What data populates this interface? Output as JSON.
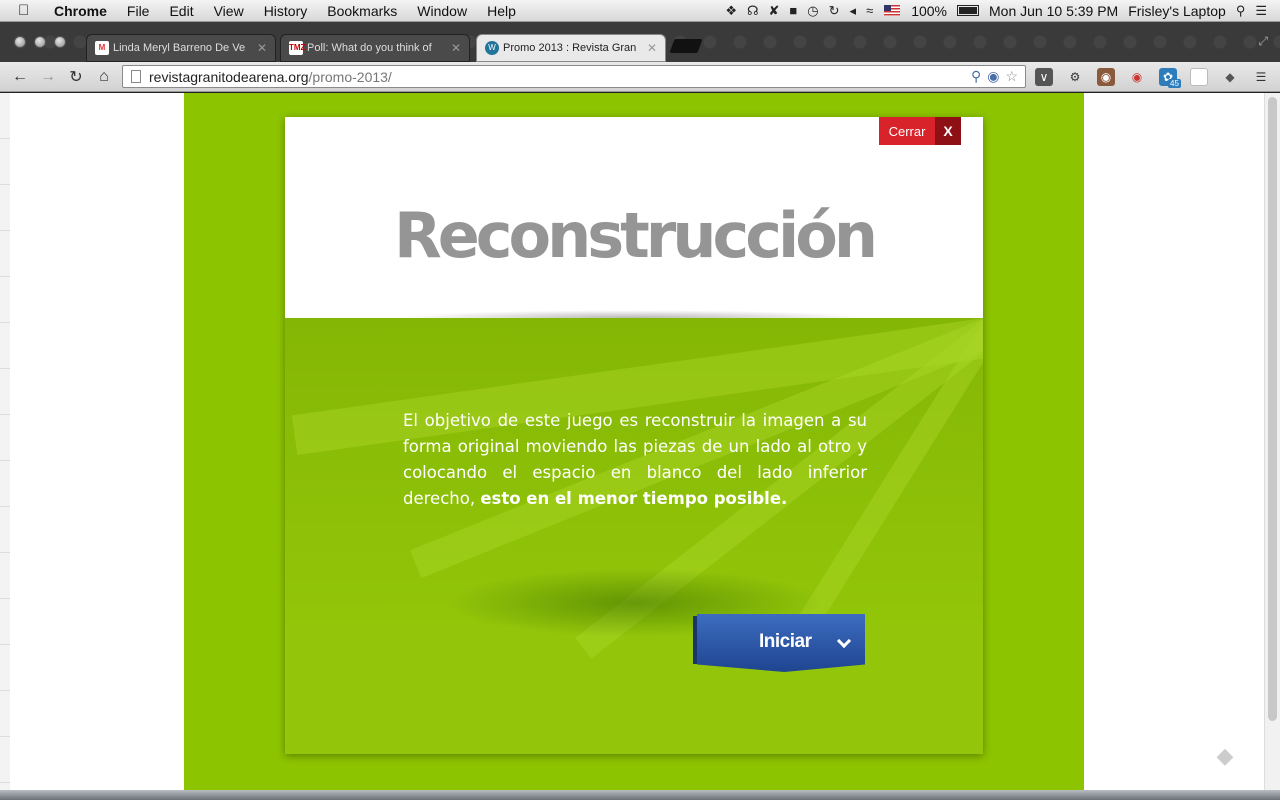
{
  "menubar": {
    "app_name": "Chrome",
    "menus": [
      "File",
      "Edit",
      "View",
      "History",
      "Bookmarks",
      "Window",
      "Help"
    ],
    "battery": "100%",
    "clock": "Mon Jun 10  5:39 PM",
    "user": "Frisley's Laptop"
  },
  "tabs": [
    {
      "title": "Linda Meryl Barreno De Ve",
      "favicon": "gmail-icon",
      "active": false
    },
    {
      "title": "Poll: What do you think of",
      "favicon": "tmz-icon",
      "favicon_text": "TMZ",
      "active": false
    },
    {
      "title": "Promo 2013 : Revista Gran",
      "favicon": "wordpress-icon",
      "active": true
    }
  ],
  "toolbar": {
    "url_domain": "revistagranitodearena.org",
    "url_path": "/promo-2013/",
    "notification_count": "45"
  },
  "modal": {
    "title": "Reconstrucción",
    "close_label": "Cerrar",
    "close_x": "X",
    "description_text": "El objetivo de este juego es reconstruir la imagen a su forma original moviendo las piezas de un lado al otro y colocando el espacio en blanco del lado inferior derecho, ",
    "description_bold": "esto en el menor tiempo posible.",
    "start_label": "Iniciar"
  },
  "colors": {
    "page_green": "#8dc400",
    "modal_green": "#93c60a",
    "close_red": "#d8232a",
    "close_dark_red": "#8e1014",
    "button_blue": "#2a55a6",
    "title_gray": "#959595"
  }
}
